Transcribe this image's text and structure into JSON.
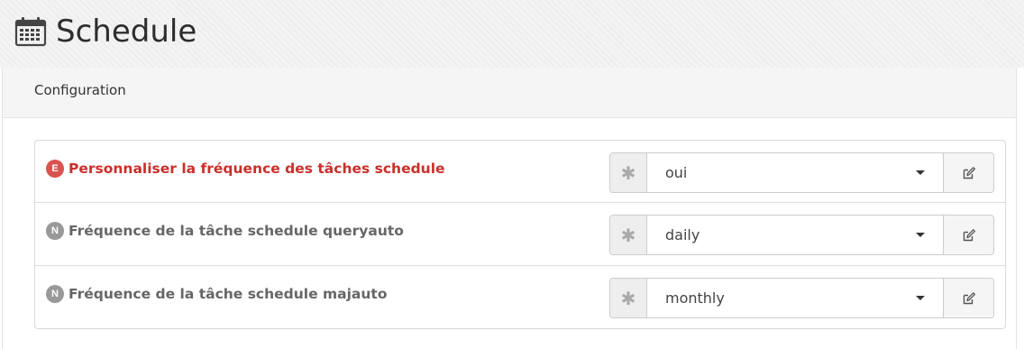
{
  "page": {
    "title": "Schedule"
  },
  "panel": {
    "heading": "Configuration"
  },
  "rows": [
    {
      "badge": "E",
      "label": "Personnaliser la fréquence des tâches schedule",
      "value": "oui",
      "required": true
    },
    {
      "badge": "N",
      "label": "Fréquence de la tâche schedule queryauto",
      "value": "daily",
      "required": false
    },
    {
      "badge": "N",
      "label": "Fréquence de la tâche schedule majauto",
      "value": "monthly",
      "required": false
    }
  ],
  "symbols": {
    "asterisk": "✱"
  },
  "colors": {
    "required": "#d9534f",
    "required_text": "#c9302c",
    "normal_badge": "#999999"
  },
  "icons": {
    "title": "calendar-icon",
    "edit": "edit-icon",
    "dropdown": "caret-down-icon"
  }
}
